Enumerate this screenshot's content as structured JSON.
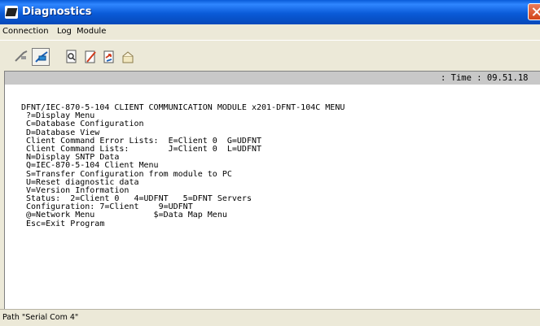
{
  "window": {
    "title": "Diagnostics"
  },
  "menu": {
    "items": [
      "Connection",
      "Log",
      "Module"
    ]
  },
  "toolbar": {
    "buttons": [
      "disconnect-icon",
      "connect-icon",
      "find-icon",
      "edit-icon",
      "transfer-icon",
      "open-box-icon"
    ]
  },
  "timebar": {
    "text": ": Time : 09.51.18"
  },
  "console": {
    "lines": [
      "DFNT/IEC-870-5-104 CLIENT COMMUNICATION MODULE x201-DFNT-104C MENU",
      " ?=Display Menu",
      " C=Database Configuration",
      " D=Database View",
      " Client Command Error Lists:  E=Client 0  G=UDFNT",
      " Client Command Lists:        J=Client 0  L=UDFNT",
      " N=Display SNTP Data",
      " Q=IEC-870-5-104 Client Menu",
      " S=Transfer Configuration from module to PC",
      " U=Reset diagnostic data",
      " V=Version Information",
      " Status:  2=Client 0   4=UDFNT   5=DFNT Servers",
      " Configuration: 7=Client    9=UDFNT",
      " @=Network Menu            $=Data Map Menu",
      " Esc=Exit Program"
    ]
  },
  "status": {
    "text": "Path \"Serial Com 4\""
  }
}
